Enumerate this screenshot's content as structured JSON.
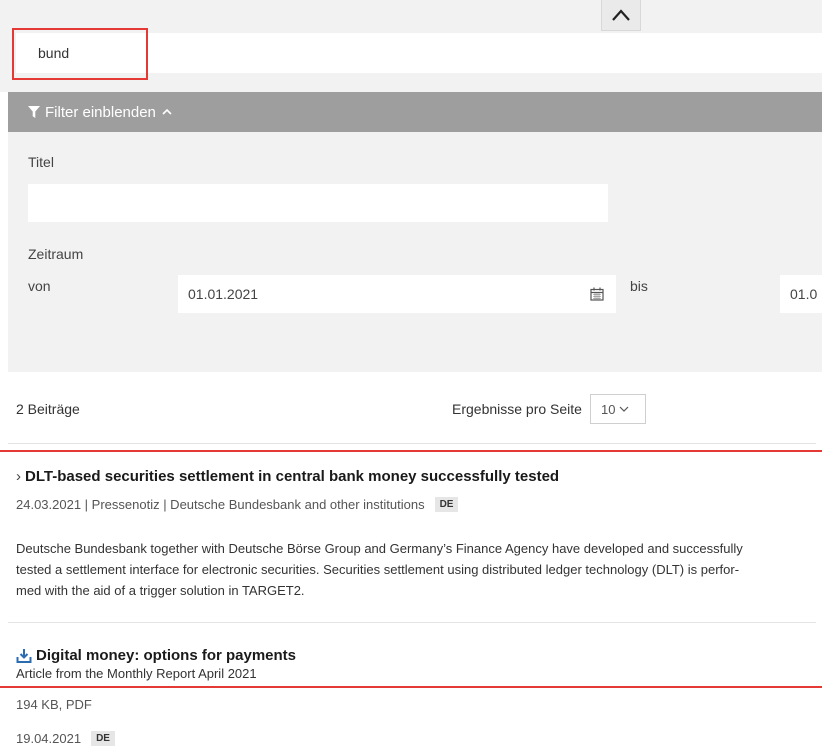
{
  "search": {
    "value": "bund"
  },
  "filter": {
    "toggle_label": "Filter einblenden",
    "title_label": "Titel",
    "title_value": "",
    "period_label": "Zeitraum",
    "from_label": "von",
    "from_value": "01.01.2021",
    "to_label": "bis",
    "to_value": "01.0"
  },
  "results_bar": {
    "count": "2 Beiträge",
    "per_page_label": "Ergebnisse pro Seite",
    "per_page_value": "10"
  },
  "results": [
    {
      "title": "DLT-based securities settlement in central bank money successfully tested",
      "meta": "24.03.2021 | Pressenotiz | Deutsche Bundesbank and other institutions",
      "lang": "DE",
      "desc_line1": "Deutsche Bundesbank together with Deutsche Börse Group and Germany’s Finance Agency have developed and successfully",
      "desc_line2": "tested a settlement interface for electronic securities. Securities settlement using distributed ledger technology (DLT) is perfor-",
      "desc_line3": "med with the aid of a trigger solution in TARGET2."
    },
    {
      "title": "Digital money: options for payments",
      "subtitle": "Article from the Monthly Report April 2021",
      "file_info": "194 KB, PDF",
      "date": "19.04.2021",
      "lang": "DE"
    }
  ],
  "colors": {
    "highlight": "#e53935",
    "filter_bar": "#9e9e9e",
    "panel_bg": "#f2f2f2",
    "download_icon": "#2b6cb0"
  },
  "icons": {
    "collapse": "chevron-up-icon",
    "filter": "filter-funnel-icon",
    "calendar": "calendar-icon",
    "select": "chevron-down-icon",
    "link": "chevron-right-icon",
    "download": "download-icon"
  }
}
